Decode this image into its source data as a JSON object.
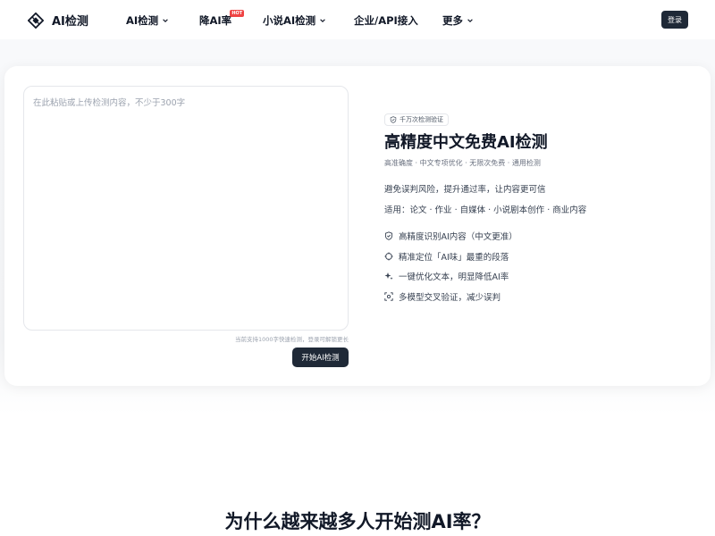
{
  "header": {
    "logo_text": "AI检测",
    "nav": {
      "ai_detect": "AI检测",
      "reduce_ai": "降AI率",
      "hot_badge": "HOT",
      "novel_detect": "小说AI检测",
      "enterprise": "企业/API接入",
      "more": "更多"
    },
    "login_label": "登录"
  },
  "editor": {
    "placeholder": "在此粘贴或上传检测内容，不少于300字",
    "hint": "当前支持1000字快速检测，登录可解锁更长",
    "start_label": "开始AI检测"
  },
  "intro": {
    "badge": "千万次检测验证",
    "title": "高精度中文免费AI检测",
    "subtitle": "高准确度 · 中文专项优化 · 无限次免费 · 通用检测",
    "desc1": "避免误判风险，提升通过率，让内容更可信",
    "desc2": "适用：论文 · 作业 · 自媒体 · 小说剧本创作 · 商业内容",
    "features": [
      {
        "icon": "shield-check-icon",
        "label": "高精度识别AI内容（中文更准）"
      },
      {
        "icon": "crosshair-icon",
        "label": "精准定位「AI味」最重的段落"
      },
      {
        "icon": "sparkle-icon",
        "label": "一键优化文本，明显降低AI率"
      },
      {
        "icon": "scan-icon",
        "label": "多模型交叉验证，减少误判"
      }
    ]
  },
  "section": {
    "title": "为什么越来越多人开始测AI率？"
  },
  "colors": {
    "primary_button": "#1f2937",
    "hot_badge": "#ef4444",
    "text_main": "#111827",
    "text_muted": "#6b7280"
  }
}
